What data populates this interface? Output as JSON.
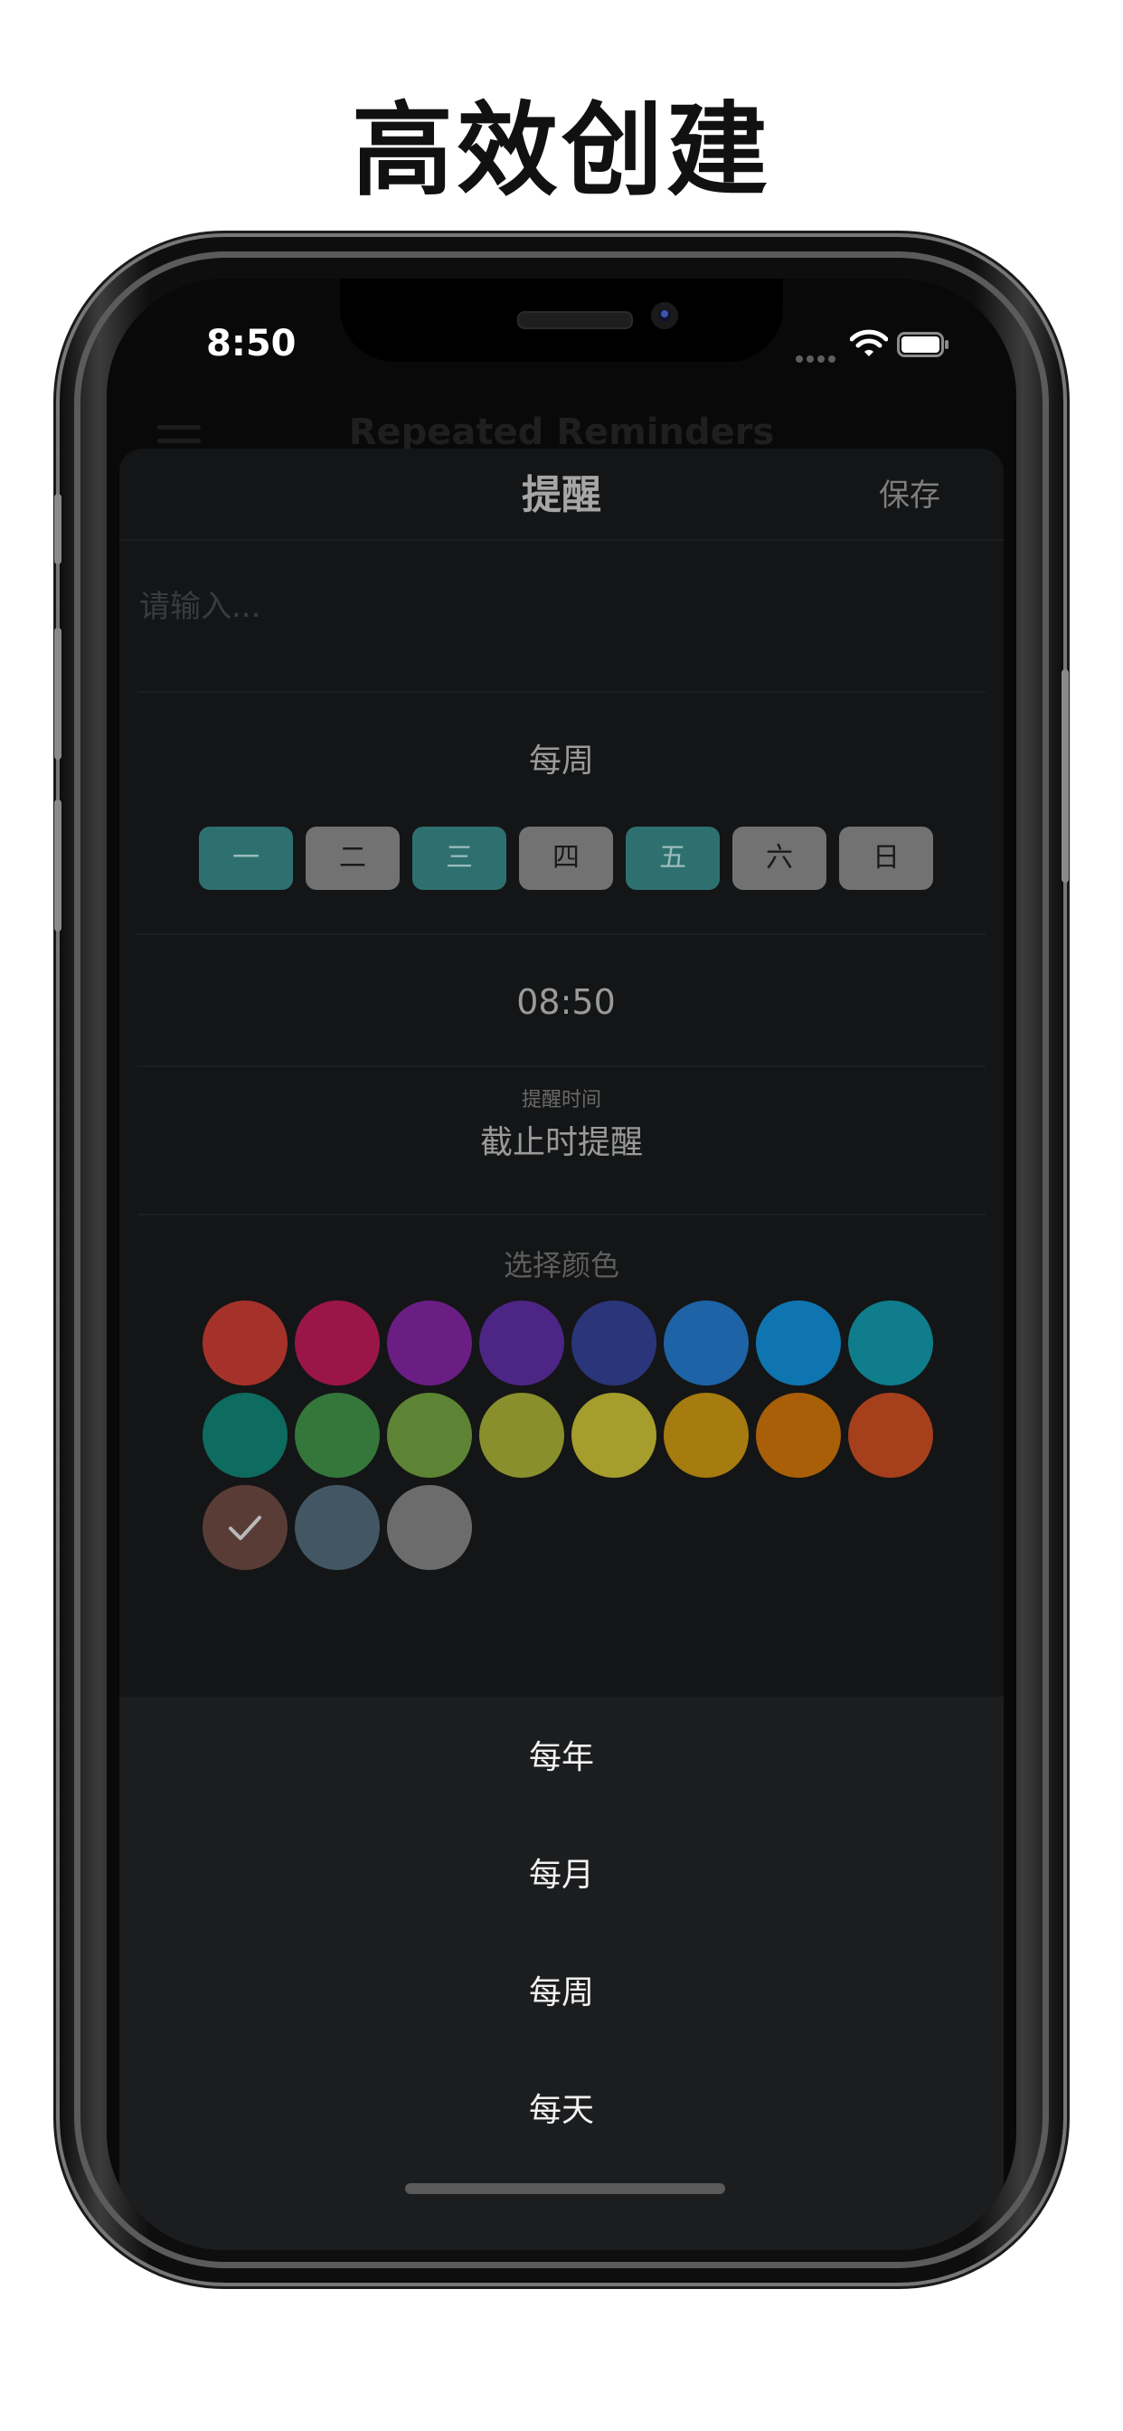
{
  "promo": {
    "title": "高效创建"
  },
  "status_bar": {
    "time": "8:50"
  },
  "background_app": {
    "title": "Repeated Reminders"
  },
  "sheet": {
    "title": "提醒",
    "save_label": "保存",
    "input_placeholder": "请输入...",
    "input_value": "",
    "repeat_mode": "每周",
    "weekdays": [
      {
        "label": "一",
        "selected": true
      },
      {
        "label": "二",
        "selected": false
      },
      {
        "label": "三",
        "selected": true
      },
      {
        "label": "四",
        "selected": false
      },
      {
        "label": "五",
        "selected": true
      },
      {
        "label": "六",
        "selected": false
      },
      {
        "label": "日",
        "selected": false
      }
    ],
    "time": "08:50",
    "reminder_label": "提醒时间",
    "reminder_value": "截止时提醒",
    "color_label": "选择颜色",
    "colors": [
      "#A5322A",
      "#9B1648",
      "#6A1E84",
      "#4C2585",
      "#2B3579",
      "#1D63A5",
      "#0F75B0",
      "#0F7D8C",
      "#0D6B5F",
      "#35773A",
      "#5D8434",
      "#888F2C",
      "#A59D2C",
      "#A67B0F",
      "#A85F08",
      "#A53F1C",
      "#5A3C37",
      "#435663",
      "#6C6C6C"
    ],
    "selected_color": "#5A3C37"
  },
  "picker": {
    "options": [
      "每年",
      "每月",
      "每周",
      "每天"
    ]
  }
}
